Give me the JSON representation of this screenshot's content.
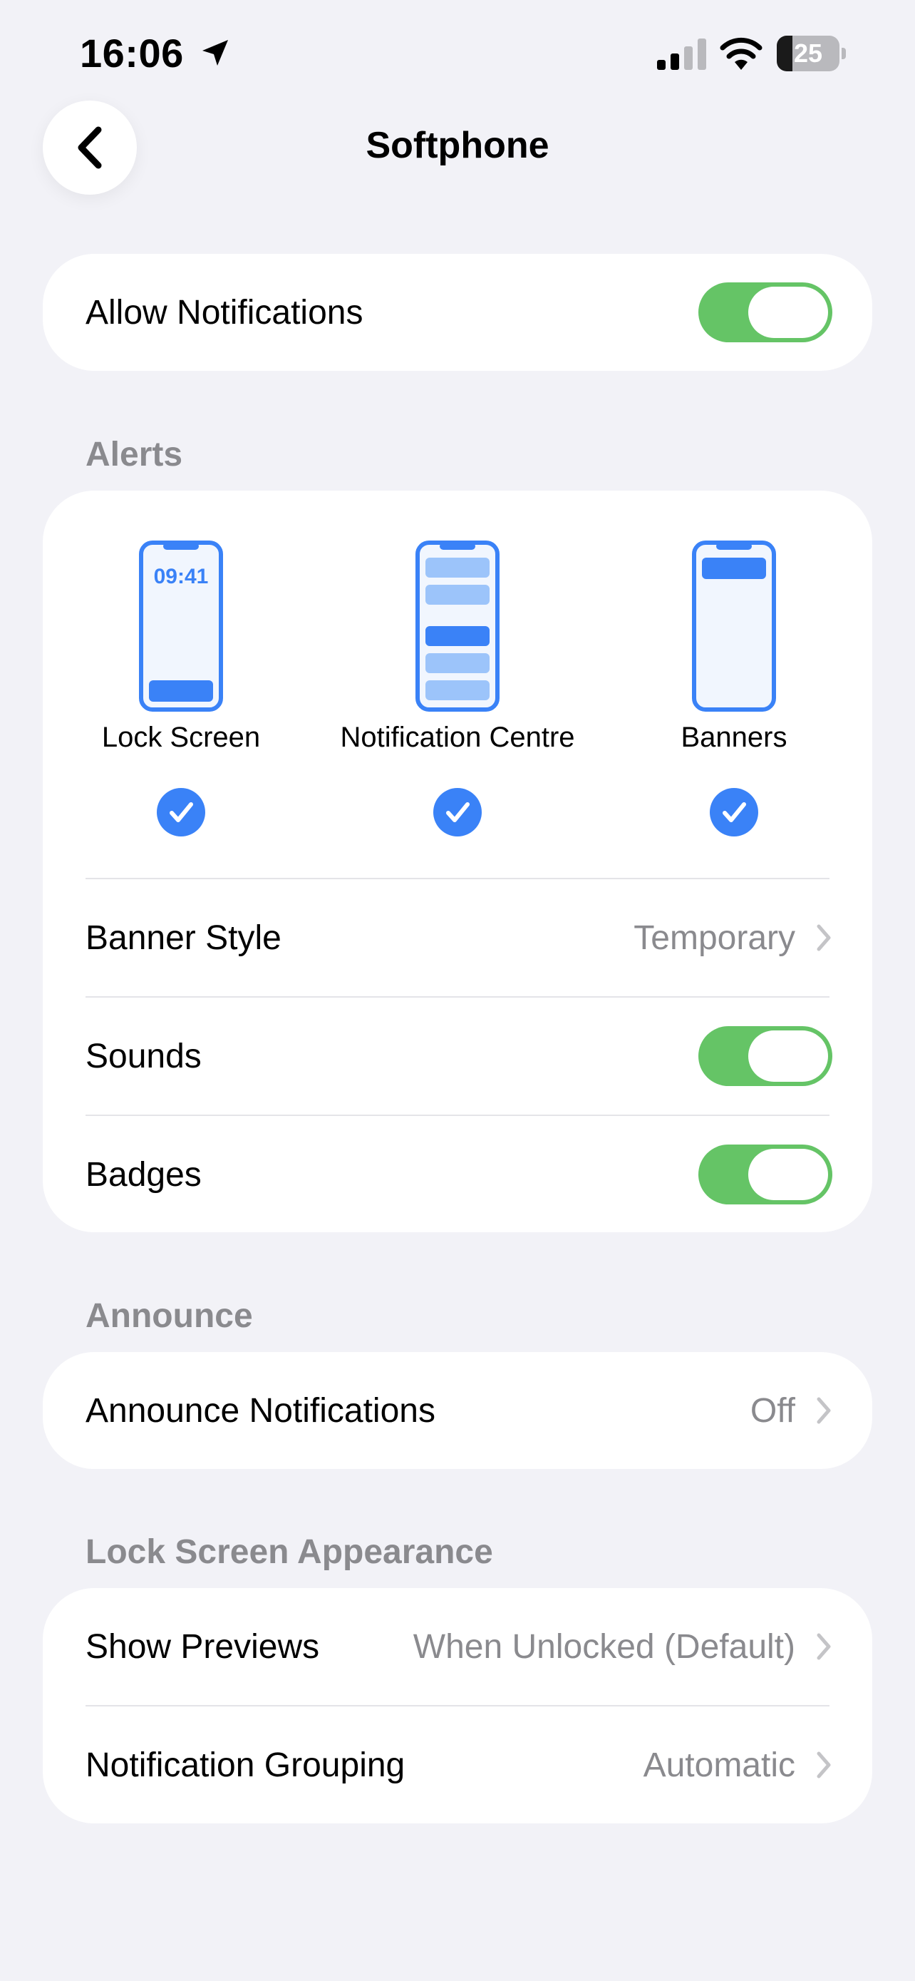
{
  "status_bar": {
    "time": "16:06",
    "battery_percent": 25,
    "icons": [
      "location-arrow-icon",
      "cellular-signal-icon",
      "wifi-icon",
      "battery-icon"
    ]
  },
  "nav": {
    "title": "Softphone",
    "back_icon": "chevron-left-icon"
  },
  "allow_notifications": {
    "label": "Allow Notifications",
    "enabled": true
  },
  "alerts": {
    "header": "Alerts",
    "options": [
      {
        "label": "Lock Screen",
        "checked": true,
        "preview_time": "09:41"
      },
      {
        "label": "Notification Centre",
        "checked": true
      },
      {
        "label": "Banners",
        "checked": true
      }
    ],
    "banner_style": {
      "label": "Banner Style",
      "value": "Temporary"
    },
    "sounds": {
      "label": "Sounds",
      "enabled": true
    },
    "badges": {
      "label": "Badges",
      "enabled": true
    }
  },
  "announce": {
    "header": "Announce",
    "announce_notifications": {
      "label": "Announce Notifications",
      "value": "Off"
    }
  },
  "lock_screen_appearance": {
    "header": "Lock Screen Appearance",
    "show_previews": {
      "label": "Show Previews",
      "value": "When Unlocked (Default)"
    },
    "notification_grouping": {
      "label": "Notification Grouping",
      "value": "Automatic"
    }
  },
  "colors": {
    "background": "#f2f2f7",
    "toggle_on": "#65c466",
    "accent_blue": "#3a82f7",
    "secondary_text": "#8a8a8e"
  }
}
